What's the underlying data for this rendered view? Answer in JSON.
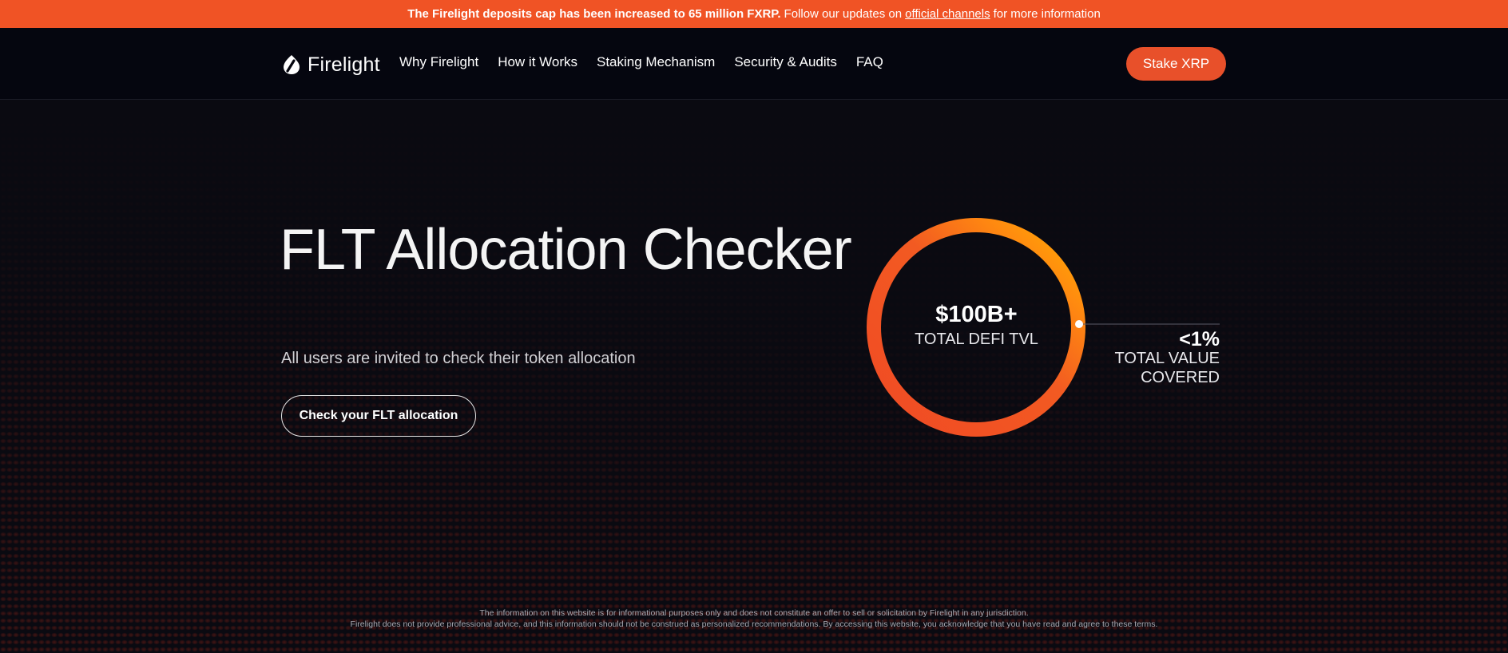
{
  "banner": {
    "lead": "The Firelight deposits cap has been increased to 65 million FXRP.",
    "follow": "Follow our updates on",
    "link": "official channels",
    "tail": "for more information"
  },
  "nav": {
    "brand": "Firelight",
    "links": [
      "Why Firelight",
      "How it Works",
      "Staking Mechanism",
      "Security & Audits",
      "FAQ"
    ],
    "cta": "Stake XRP"
  },
  "hero": {
    "title": "FLT Allocation Checker",
    "subtitle": "All users are invited to check their token allocation",
    "button": "Check your FLT allocation"
  },
  "stats": {
    "tvl_value": "$100B+",
    "tvl_label": "TOTAL DEFI TVL",
    "coverage_value": "<1%",
    "coverage_label_line1": "TOTAL VALUE",
    "coverage_label_line2": "COVERED"
  },
  "footer": {
    "line1": "The information on this website is for informational purposes only and does not constitute an offer to sell or solicitation by Firelight in any jurisdiction.",
    "line2": "Firelight does not provide professional advice, and this information should not be construed as personalized recommendations. By accessing this website, you acknowledge that you have read and agree to these terms."
  },
  "colors": {
    "banner": "#f05325",
    "accent": "#e8502a",
    "ring_start": "#f04a24",
    "ring_end": "#ffb000",
    "nav_bg": "#05060f"
  }
}
